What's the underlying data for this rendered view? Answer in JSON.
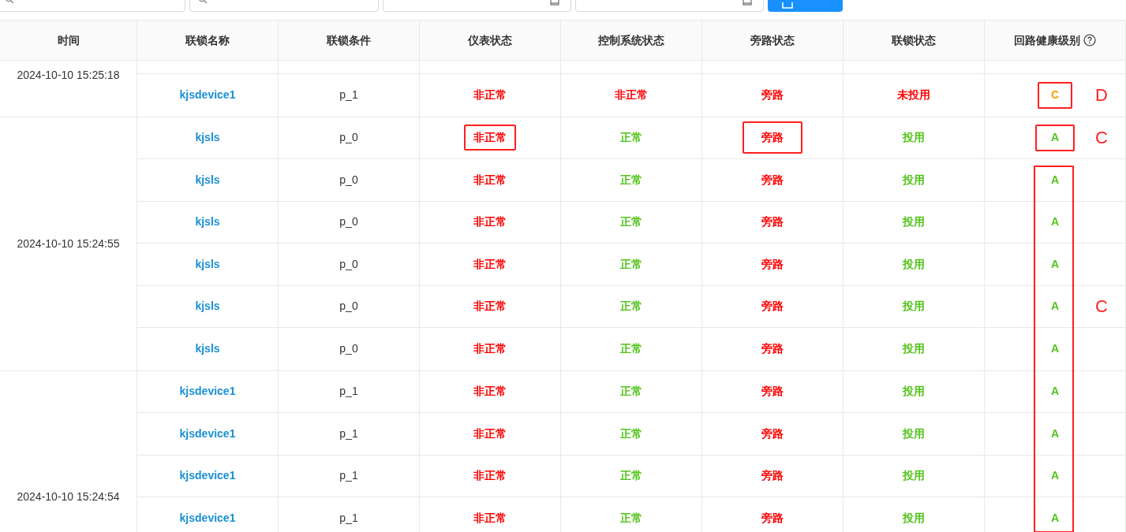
{
  "filters": [
    {
      "kind": "search"
    },
    {
      "kind": "search"
    },
    {
      "kind": "date"
    },
    {
      "kind": "date"
    },
    {
      "kind": "export"
    }
  ],
  "columns": [
    {
      "label": "时间",
      "help": false
    },
    {
      "label": "联锁名称",
      "help": false
    },
    {
      "label": "联锁条件",
      "help": false
    },
    {
      "label": "仪表状态",
      "help": false
    },
    {
      "label": "控制系统状态",
      "help": false
    },
    {
      "label": "旁路状态",
      "help": false
    },
    {
      "label": "联锁状态",
      "help": false
    },
    {
      "label": "回路健康级别",
      "help": true
    }
  ],
  "groups": [
    {
      "time": "2024-10-10 15:25:18",
      "rows": [
        {
          "name": "kjsdevice1",
          "condition": "p_1",
          "cells": [
            {
              "text": "非正常",
              "abnormal": true,
              "boxed": false
            },
            {
              "text": "非正常",
              "abnormal": true,
              "boxed": false
            },
            {
              "text": "旁路",
              "abnormal": true,
              "boxed": false
            },
            {
              "text": "未投用",
              "abnormal": true,
              "boxed": false
            }
          ],
          "grade": {
            "text": "C",
            "color": "#fa9c00",
            "boxed": true,
            "spanned": false
          },
          "note": "D"
        }
      ]
    },
    {
      "time": "2024-10-10 15:24:55",
      "rows": [
        {
          "name": "kjsls",
          "condition": "p_0",
          "cells": [
            {
              "text": "非正常",
              "abnormal": true,
              "boxed": true
            },
            {
              "text": "正常",
              "abnormal": false,
              "boxed": false
            },
            {
              "text": "旁路",
              "abnormal": true,
              "boxed": true
            },
            {
              "text": "投用",
              "abnormal": false,
              "boxed": false
            }
          ],
          "grade": {
            "text": "A",
            "color": "#52c41a",
            "boxed": true,
            "spanned": false
          },
          "note": "C"
        },
        {
          "name": "kjsls",
          "condition": "p_0",
          "cells": [
            {
              "text": "非正常",
              "abnormal": true,
              "boxed": false
            },
            {
              "text": "正常",
              "abnormal": false,
              "boxed": false
            },
            {
              "text": "旁路",
              "abnormal": true,
              "boxed": false
            },
            {
              "text": "投用",
              "abnormal": false,
              "boxed": false
            }
          ],
          "grade": {
            "text": "A",
            "color": "#52c41a",
            "boxed": false,
            "spanned": true
          }
        },
        {
          "name": "kjsls",
          "condition": "p_0",
          "cells": [
            {
              "text": "非正常",
              "abnormal": true,
              "boxed": false
            },
            {
              "text": "正常",
              "abnormal": false,
              "boxed": false
            },
            {
              "text": "旁路",
              "abnormal": true,
              "boxed": false
            },
            {
              "text": "投用",
              "abnormal": false,
              "boxed": false
            }
          ],
          "grade": {
            "text": "A",
            "color": "#52c41a",
            "boxed": false,
            "spanned": true
          }
        },
        {
          "name": "kjsls",
          "condition": "p_0",
          "cells": [
            {
              "text": "非正常",
              "abnormal": true,
              "boxed": false
            },
            {
              "text": "正常",
              "abnormal": false,
              "boxed": false
            },
            {
              "text": "旁路",
              "abnormal": true,
              "boxed": false
            },
            {
              "text": "投用",
              "abnormal": false,
              "boxed": false
            }
          ],
          "grade": {
            "text": "A",
            "color": "#52c41a",
            "boxed": false,
            "spanned": true
          }
        },
        {
          "name": "kjsls",
          "condition": "p_0",
          "cells": [
            {
              "text": "非正常",
              "abnormal": true,
              "boxed": false
            },
            {
              "text": "正常",
              "abnormal": false,
              "boxed": false
            },
            {
              "text": "旁路",
              "abnormal": true,
              "boxed": false
            },
            {
              "text": "投用",
              "abnormal": false,
              "boxed": false
            }
          ],
          "grade": {
            "text": "A",
            "color": "#52c41a",
            "boxed": false,
            "spanned": true
          },
          "note": "C"
        },
        {
          "name": "kjsls",
          "condition": "p_0",
          "cells": [
            {
              "text": "非正常",
              "abnormal": true,
              "boxed": false
            },
            {
              "text": "正常",
              "abnormal": false,
              "boxed": false
            },
            {
              "text": "旁路",
              "abnormal": true,
              "boxed": false
            },
            {
              "text": "投用",
              "abnormal": false,
              "boxed": false
            }
          ],
          "grade": {
            "text": "A",
            "color": "#52c41a",
            "boxed": false,
            "spanned": true
          }
        }
      ]
    },
    {
      "time": "2024-10-10 15:24:54",
      "rows": [
        {
          "name": "kjsdevice1",
          "condition": "p_1",
          "cells": [
            {
              "text": "非正常",
              "abnormal": true,
              "boxed": false
            },
            {
              "text": "正常",
              "abnormal": false,
              "boxed": false
            },
            {
              "text": "旁路",
              "abnormal": true,
              "boxed": false
            },
            {
              "text": "投用",
              "abnormal": false,
              "boxed": false
            }
          ],
          "grade": {
            "text": "A",
            "color": "#52c41a",
            "boxed": false,
            "spanned": true
          }
        },
        {
          "name": "kjsdevice1",
          "condition": "p_1",
          "cells": [
            {
              "text": "非正常",
              "abnormal": true,
              "boxed": false
            },
            {
              "text": "正常",
              "abnormal": false,
              "boxed": false
            },
            {
              "text": "旁路",
              "abnormal": true,
              "boxed": false
            },
            {
              "text": "投用",
              "abnormal": false,
              "boxed": false
            }
          ],
          "grade": {
            "text": "A",
            "color": "#52c41a",
            "boxed": false,
            "spanned": true
          }
        },
        {
          "name": "kjsdevice1",
          "condition": "p_1",
          "cells": [
            {
              "text": "非正常",
              "abnormal": true,
              "boxed": false
            },
            {
              "text": "正常",
              "abnormal": false,
              "boxed": false
            },
            {
              "text": "旁路",
              "abnormal": true,
              "boxed": false
            },
            {
              "text": "投用",
              "abnormal": false,
              "boxed": false
            }
          ],
          "grade": {
            "text": "A",
            "color": "#52c41a",
            "boxed": false,
            "spanned": true
          }
        },
        {
          "name": "kjsdevice1",
          "condition": "p_1",
          "cells": [
            {
              "text": "非正常",
              "abnormal": true,
              "boxed": false
            },
            {
              "text": "正常",
              "abnormal": false,
              "boxed": false
            },
            {
              "text": "旁路",
              "abnormal": true,
              "boxed": false
            },
            {
              "text": "投用",
              "abnormal": false,
              "boxed": false
            }
          ],
          "grade": {
            "text": "A",
            "color": "#52c41a",
            "boxed": false,
            "spanned": true
          }
        }
      ]
    }
  ]
}
